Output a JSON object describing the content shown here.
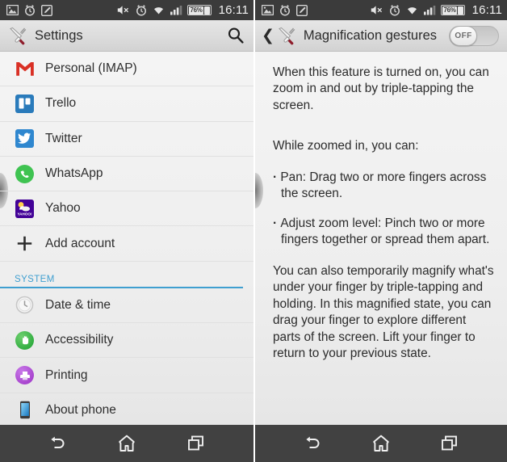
{
  "statusbar": {
    "icons_left": [
      "image-icon",
      "alarm-clock-icon",
      "note-edit-icon"
    ],
    "icons_right": [
      "volume-mute-icon",
      "alarm-clock-icon",
      "wifi-icon",
      "signal-bars-icon"
    ],
    "battery_percent": "76%",
    "time": "16:11"
  },
  "left_screen": {
    "actionbar": {
      "icon": "settings-tools-icon",
      "title": "Settings",
      "search_icon": "search-icon"
    },
    "list": [
      {
        "label": "Personal (IMAP)",
        "icon": "gmail-icon"
      },
      {
        "label": "Trello",
        "icon": "trello-icon"
      },
      {
        "label": "Twitter",
        "icon": "twitter-icon"
      },
      {
        "label": "WhatsApp",
        "icon": "whatsapp-icon"
      },
      {
        "label": "Yahoo",
        "icon": "yahoo-icon"
      },
      {
        "label": "Add account",
        "icon": "plus-icon"
      }
    ],
    "section_header": "SYSTEM",
    "system_list": [
      {
        "label": "Date & time",
        "icon": "clock-icon"
      },
      {
        "label": "Accessibility",
        "icon": "accessibility-hand-icon"
      },
      {
        "label": "Printing",
        "icon": "printer-icon"
      },
      {
        "label": "About phone",
        "icon": "phone-icon"
      }
    ]
  },
  "right_screen": {
    "actionbar": {
      "back_icon": "back-chevron-icon",
      "icon": "settings-tools-icon",
      "title": "Magnification gestures",
      "toggle_label": "OFF",
      "toggle_state": "off"
    },
    "description": {
      "intro": "When this feature is turned on, you can zoom in and out by triple-tapping the screen.",
      "subhead": "While zoomed in, you can:",
      "bullets": [
        "Pan: Drag two or more fingers across the screen.",
        "Adjust zoom level: Pinch two or more fingers together or spread them apart."
      ],
      "outro": "You can also temporarily magnify what's under your finger by triple-tapping and holding. In this magnified state, you can drag your finger to explore different parts of the screen. Lift your finger to return to your previous state."
    }
  },
  "navbar": {
    "buttons": [
      "back-nav-icon",
      "home-nav-icon",
      "recents-nav-icon"
    ]
  },
  "colors": {
    "accent": "#3f9fd0",
    "statusbar_bg": "#3b3b3b",
    "navbar_bg": "#414141"
  }
}
